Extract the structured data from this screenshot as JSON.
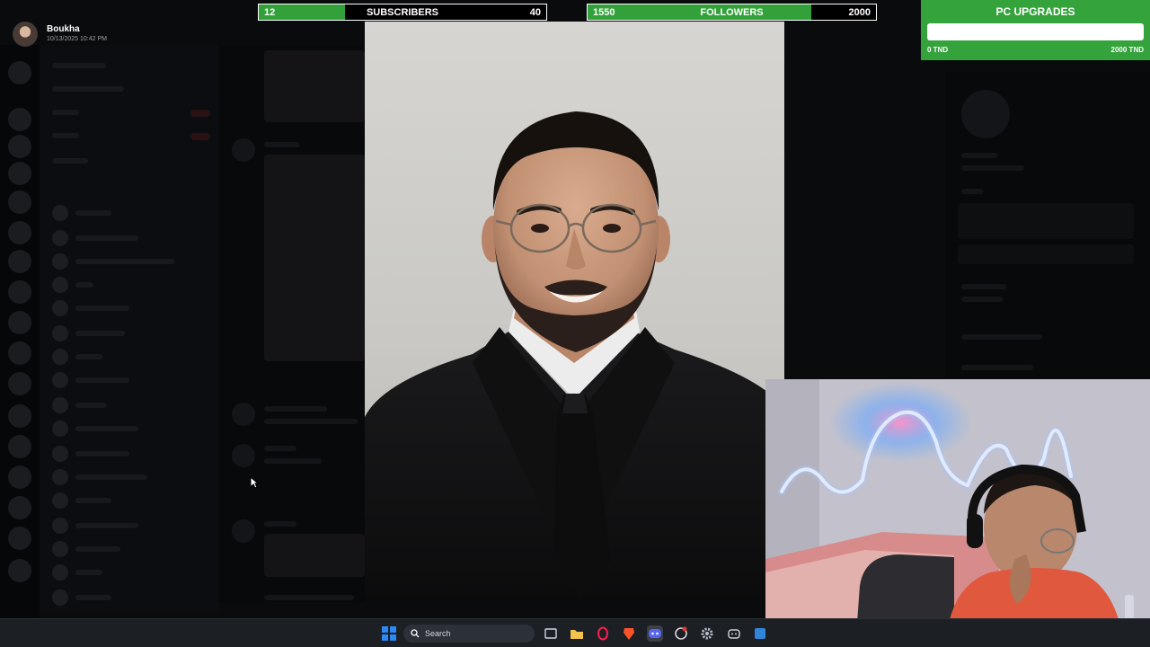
{
  "user": {
    "name": "Boukha",
    "timestamp": "10/13/2025 10:42 PM"
  },
  "subscribers_goal": {
    "current": "12",
    "label": "SUBSCRIBERS",
    "target": "40",
    "progress": 0.3
  },
  "followers_goal": {
    "current": "1550",
    "label": "FOLLOWERS",
    "target": "2000",
    "progress": 0.775
  },
  "pc_upgrades": {
    "title": "PC UPGRADES",
    "min_label": "0 TND",
    "max_label": "2000 TND",
    "progress": 0
  },
  "taskbar": {
    "search_label": "Search",
    "icons": [
      "windows-start-icon",
      "search-icon",
      "task-view-icon",
      "file-explorer-icon",
      "opera-gx-icon",
      "brave-icon",
      "discord-icon",
      "capture-icon",
      "settings-icon",
      "app-icon",
      "app-icon-2"
    ]
  },
  "colors": {
    "goal_green": "#33a13a",
    "widget_green": "#35a33c",
    "taskbar": "#1c1f24"
  }
}
